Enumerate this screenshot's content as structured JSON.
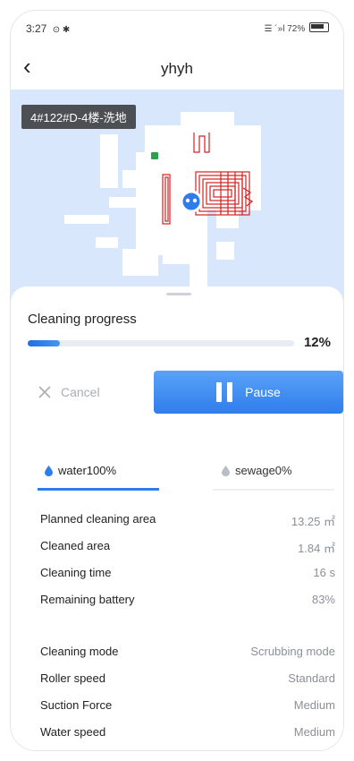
{
  "status_bar": {
    "time": "3:27",
    "icons_left": "⊙ ✱",
    "signal_text": "☰ ´»l",
    "battery_text": "72%"
  },
  "nav": {
    "back_icon": "‹",
    "title": "yhyh"
  },
  "map": {
    "location_tag": "4#122#D-4楼-洗地",
    "background_color": "#d8e7fb",
    "path_color": "#d62020",
    "robot_color": "#2f7ded"
  },
  "progress": {
    "label": "Cleaning progress",
    "percent_text": "12%",
    "percent": 0.12
  },
  "actions": {
    "cancel_label": "Cancel",
    "pause_label": "Pause"
  },
  "tabs": {
    "water": "water100%",
    "sewage": "sewage0%"
  },
  "stats": [
    {
      "label": "Planned cleaning area",
      "value": "13.25 ㎡"
    },
    {
      "label": "Cleaned area",
      "value": "1.84 ㎡"
    },
    {
      "label": "Cleaning time",
      "value": "16 s"
    },
    {
      "label": "Remaining battery",
      "value": "83%"
    }
  ],
  "settings": [
    {
      "label": "Cleaning mode",
      "value": "Scrubbing mode"
    },
    {
      "label": "Roller speed",
      "value": "Standard"
    },
    {
      "label": "Suction Force",
      "value": "Medium"
    },
    {
      "label": "Water speed",
      "value": "Medium"
    }
  ],
  "colors": {
    "accent": "#2f7ded",
    "muted": "#8c9096"
  }
}
